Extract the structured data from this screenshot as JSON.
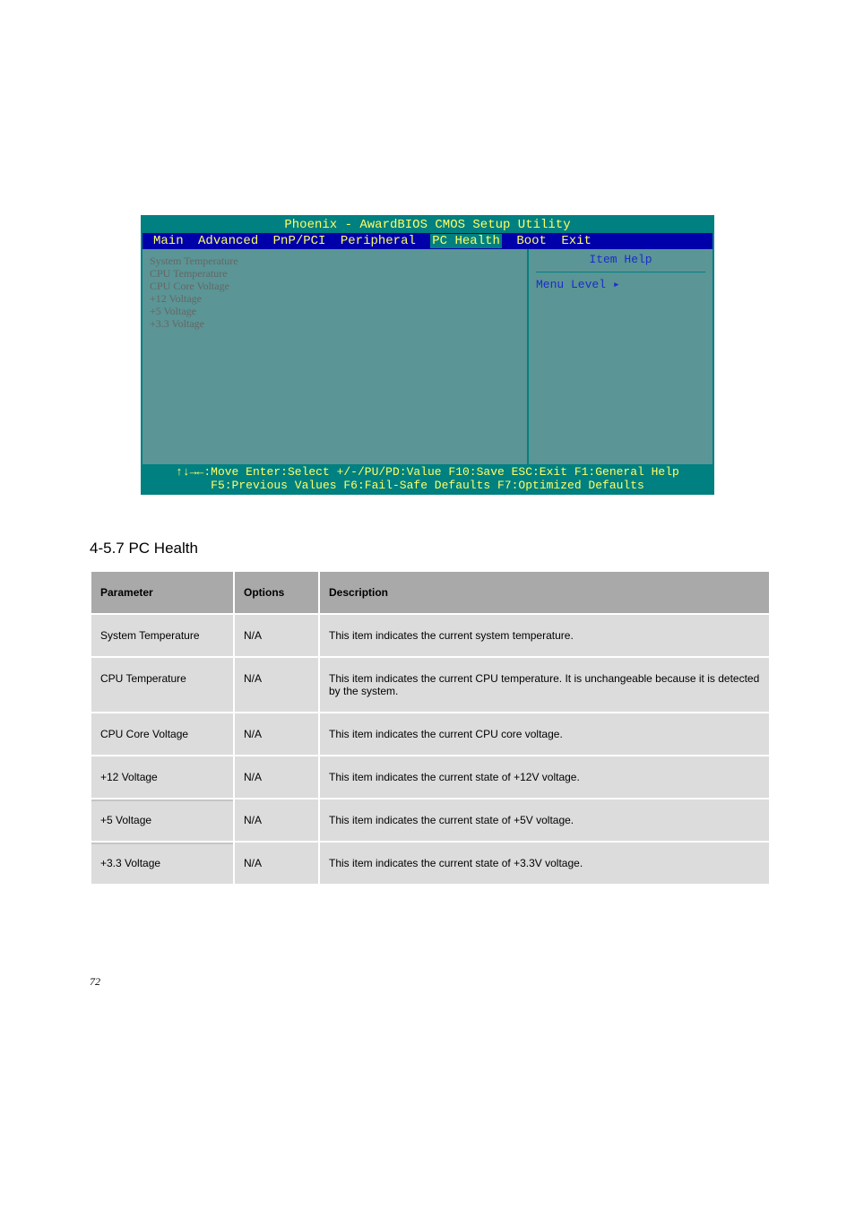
{
  "bios": {
    "title": "Phoenix - AwardBIOS CMOS Setup Utility",
    "tabs": {
      "main": "Main",
      "advanced": "Advanced",
      "pnp": "PnP/PCI",
      "peripheral": "Peripheral",
      "pchealth": "PC Health",
      "boot": "Boot",
      "exit": "Exit"
    },
    "left_items": {
      "systemp": "System Temperature",
      "cputemp": "CPU Temperature",
      "cpucore": "CPU Core Voltage",
      "v12": "+12 Voltage",
      "v5": "+5 Voltage",
      "v33": "+3.3 Voltage"
    },
    "right": {
      "help": "Item Help",
      "level": "Menu Level   ▸"
    },
    "footer_line1": "↑↓→←:Move  Enter:Select  +/-/PU/PD:Value  F10:Save  ESC:Exit  F1:General Help",
    "footer_line2": "F5:Previous Values    F6:Fail-Safe Defaults    F7:Optimized Defaults"
  },
  "section": {
    "heading": "4-5.7 PC Health",
    "pagenum": "72"
  },
  "table": {
    "headers": {
      "param": "Parameter",
      "options": "Options",
      "desc": "Description"
    },
    "rows": [
      {
        "param": "System Temperature",
        "options": "N/A",
        "desc": "This item indicates the current system temperature."
      },
      {
        "param": "CPU Temperature",
        "options": "N/A",
        "desc": "This item indicates the current CPU temperature. It is unchangeable because it is detected by the system."
      },
      {
        "param": "CPU Core Voltage",
        "options": "N/A",
        "desc": "This item indicates the current CPU core voltage."
      },
      {
        "param": "+12 Voltage",
        "options": "N/A",
        "desc": "This item indicates the current state of +12V voltage."
      },
      {
        "param": "+5 Voltage",
        "options": "N/A",
        "desc": "This item indicates the current state of +5V voltage."
      },
      {
        "param": "+3.3 Voltage",
        "options": "N/A",
        "desc": "This item indicates the current state of +3.3V voltage."
      }
    ]
  }
}
